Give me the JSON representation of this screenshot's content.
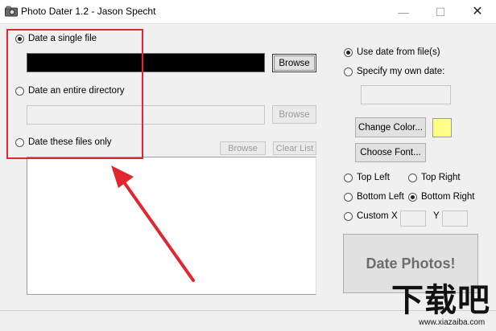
{
  "window": {
    "title": "Photo Dater 1.2 - Jason Specht",
    "minimize": "—",
    "maximize": "☐",
    "close": "✕"
  },
  "source": {
    "single_file_label": "Date a single file",
    "single_file_value": "",
    "directory_label": "Date an entire directory",
    "directory_value": "",
    "files_only_label": "Date these files only",
    "browse_label": "Browse",
    "clear_list_label": "Clear List"
  },
  "date_options": {
    "use_file_date": "Use date from file(s)",
    "own_date": "Specify my own date:",
    "own_date_value": ""
  },
  "style": {
    "change_color": "Change Color...",
    "change_font": "Choose Font...",
    "swatch_color": "#ffff88"
  },
  "position": {
    "top_left": "Top Left",
    "top_right": "Top Right",
    "bottom_left": "Bottom Left",
    "bottom_right": "Bottom Right",
    "custom": "Custom",
    "x_label": "X",
    "y_label": "Y",
    "x_value": "",
    "y_value": ""
  },
  "action": {
    "date_photos": "Date Photos!"
  },
  "watermark": {
    "site_name": "下载吧",
    "site_url": "www.xiazaiba.com"
  }
}
